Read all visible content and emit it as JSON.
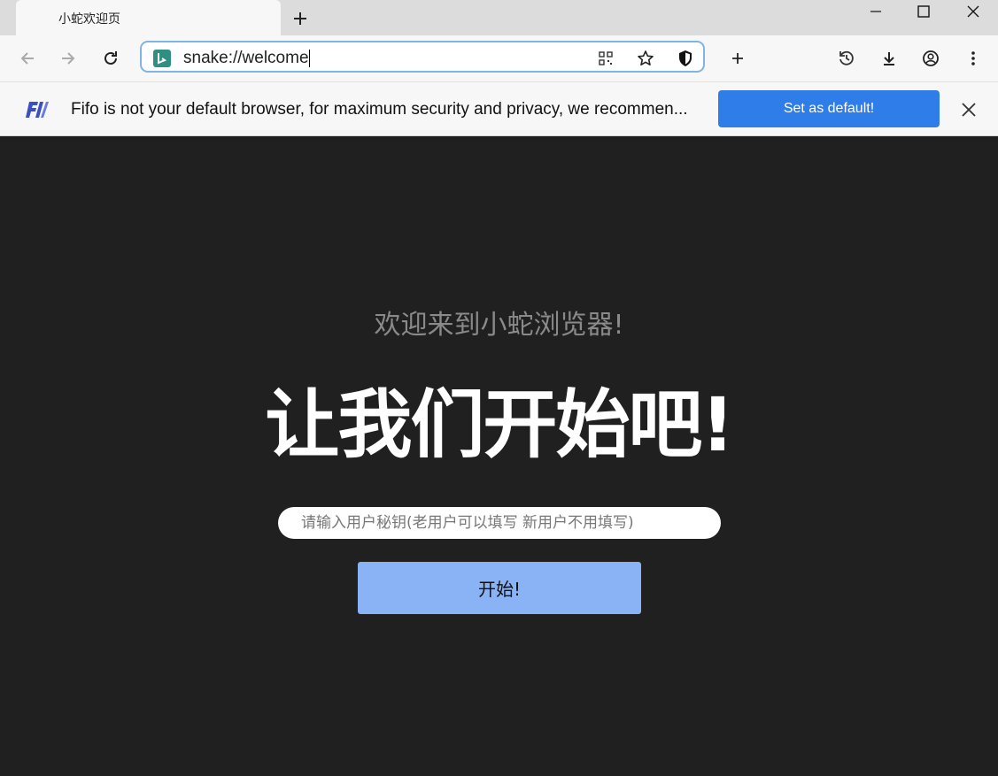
{
  "window": {
    "tab_title": "小蛇欢迎页",
    "controls": {
      "minimize_icon": "minimize-icon",
      "maximize_icon": "maximize-icon",
      "close_icon": "close-icon"
    }
  },
  "toolbar": {
    "url": "snake://welcome",
    "icons": [
      "back-arrow-icon",
      "forward-arrow-icon",
      "reload-icon",
      "qr-code-icon",
      "bookmark-star-icon",
      "shield-icon",
      "plus-icon",
      "history-icon",
      "download-icon",
      "account-icon",
      "more-vert-icon"
    ]
  },
  "infobar": {
    "message": "Fifo is not your default browser, for maximum security and privacy, we recommen...",
    "button_label": "Set as default!",
    "accent_color": "#2e7de8"
  },
  "main": {
    "welcome": "欢迎来到小蛇浏览器!",
    "headline": "让我们开始吧!",
    "input_placeholder": "请输入用户秘钥(老用户可以填写 新用户不用填写)",
    "start_label": "开始!",
    "start_color": "#8ab3f5"
  }
}
